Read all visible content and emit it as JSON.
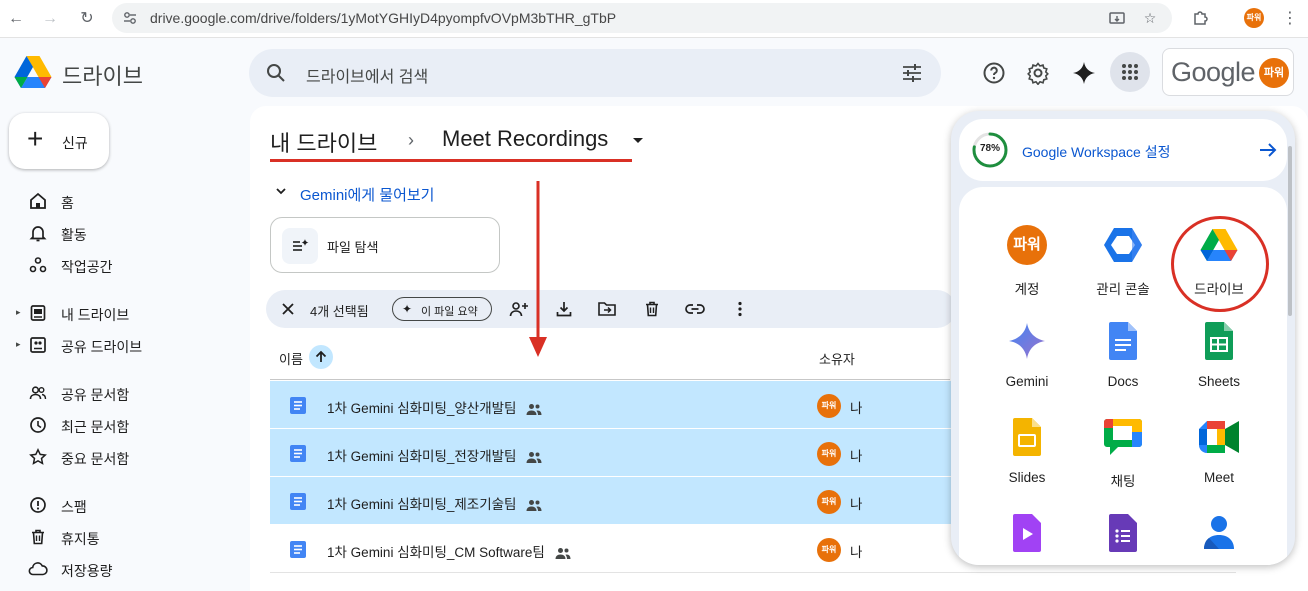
{
  "browser": {
    "url": "drive.google.com/drive/folders/1yMotYGHIyD4pyompfvOVpM3bTHR_gTbP",
    "profile_avatar_text": "파워"
  },
  "app": {
    "title": "드라이브",
    "search_placeholder": "드라이브에서 검색",
    "google_wordmark": "Google",
    "account_avatar_text": "파워"
  },
  "sidebar": {
    "new_label": "신규",
    "items": [
      {
        "label": "홈",
        "icon": "home-icon"
      },
      {
        "label": "활동",
        "icon": "bell-icon"
      },
      {
        "label": "작업공간",
        "icon": "workspaces-icon"
      },
      {
        "label": "내 드라이브",
        "icon": "my-drive-icon"
      },
      {
        "label": "공유 드라이브",
        "icon": "shared-drives-icon"
      },
      {
        "label": "공유 문서함",
        "icon": "people-icon"
      },
      {
        "label": "최근 문서함",
        "icon": "clock-icon"
      },
      {
        "label": "중요 문서함",
        "icon": "star-icon"
      },
      {
        "label": "스팸",
        "icon": "spam-icon"
      },
      {
        "label": "휴지통",
        "icon": "trash-icon"
      },
      {
        "label": "저장용량",
        "icon": "cloud-icon"
      }
    ]
  },
  "main": {
    "breadcrumb_root": "내 드라이브",
    "breadcrumb_sep": "›",
    "breadcrumb_current": "Meet Recordings",
    "gemini_prompt": "Gemini에게 물어보기",
    "explore_label": "파일 탐색",
    "selection": {
      "count_label": "4개 선택됨",
      "summary_label": "이 파일 요약"
    },
    "columns": {
      "name": "이름",
      "owner": "소유자"
    },
    "files": [
      {
        "name": "1차 Gemini 심화미팅_양산개발팀",
        "owner": "나",
        "owner_avatar": "파워",
        "selected": true
      },
      {
        "name": "1차 Gemini 심화미팅_전장개발팀",
        "owner": "나",
        "owner_avatar": "파워",
        "selected": true
      },
      {
        "name": "1차 Gemini 심화미팅_제조기술팀",
        "owner": "나",
        "owner_avatar": "파워",
        "selected": true
      },
      {
        "name": "1차 Gemini 심화미팅_CM Software팀",
        "owner": "나",
        "owner_avatar": "파워",
        "selected": false
      }
    ]
  },
  "apps_popup": {
    "storage_percent": "78%",
    "storage_fraction": 0.78,
    "workspace_label": "Google Workspace 설정",
    "apps": [
      {
        "label": "계정",
        "icon": "account-avatar-icon",
        "avatar_text": "파워"
      },
      {
        "label": "관리 콘솔",
        "icon": "admin-console-icon"
      },
      {
        "label": "드라이브",
        "icon": "drive-icon"
      },
      {
        "label": "Gemini",
        "icon": "gemini-icon"
      },
      {
        "label": "Docs",
        "icon": "docs-icon"
      },
      {
        "label": "Sheets",
        "icon": "sheets-icon"
      },
      {
        "label": "Slides",
        "icon": "slides-icon"
      },
      {
        "label": "채팅",
        "icon": "chat-icon"
      },
      {
        "label": "Meet",
        "icon": "meet-icon"
      },
      {
        "label": "",
        "icon": "vids-icon"
      },
      {
        "label": "",
        "icon": "forms-icon"
      },
      {
        "label": "",
        "icon": "contacts-icon"
      }
    ]
  },
  "colors": {
    "selected_row": "#c2e7ff",
    "accent_blue": "#0b57d0",
    "annotation_red": "#d93025",
    "avatar_orange": "#e8710a"
  }
}
